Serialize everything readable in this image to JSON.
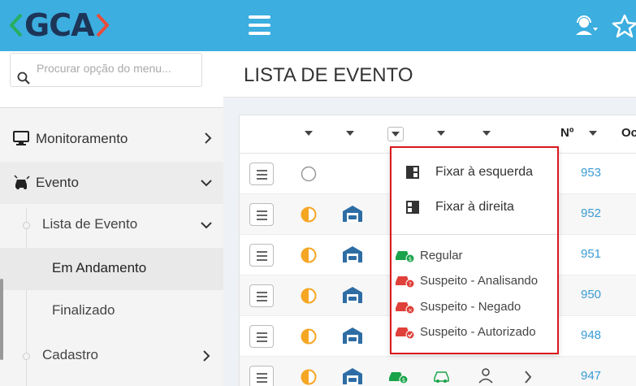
{
  "app": {
    "logo_text": "GCA"
  },
  "colors": {
    "topbar": "#3caee0",
    "accent_link": "#3a9bd5",
    "dropdown_border": "#d9191d",
    "regular_green": "#1aa34a",
    "suspect_red": "#e0403a",
    "status_orange": "#f5a623",
    "garage_blue": "#2e6da4"
  },
  "header": {
    "icons": [
      "hamburger-icon",
      "user-headset-icon",
      "star-icon"
    ]
  },
  "sidebar": {
    "search_placeholder": "Procurar opção do menu...",
    "items": [
      {
        "label": "Monitoramento",
        "icon": "monitor-icon"
      },
      {
        "label": "Evento",
        "icon": "car-alert-icon"
      }
    ],
    "subitems": [
      {
        "label": "Lista de Evento"
      },
      {
        "label": "Em Andamento"
      },
      {
        "label": "Finalizado"
      },
      {
        "label": "Cadastro"
      }
    ]
  },
  "main": {
    "page_title": "LISTA DE EVENTO",
    "grid": {
      "headers": {
        "number": "Nº",
        "next": "Oc"
      },
      "rows": [
        {
          "number": "953",
          "status": "empty"
        },
        {
          "number": "952",
          "status": "half"
        },
        {
          "number": "951",
          "status": "half"
        },
        {
          "number": "950",
          "status": "half"
        },
        {
          "number": "948",
          "status": "half"
        },
        {
          "number": "947",
          "status": "half"
        }
      ]
    },
    "dropdown": {
      "pin_left": "Fixar à esquerda",
      "pin_right": "Fixar à direita",
      "filters": [
        {
          "label": "Regular",
          "icon": "car-regular-icon",
          "color": "#1aa34a"
        },
        {
          "label": "Suspeito - Analisando",
          "icon": "car-question-icon",
          "color": "#e0403a"
        },
        {
          "label": "Suspeito - Negado",
          "icon": "car-denied-icon",
          "color": "#e0403a"
        },
        {
          "label": "Suspeito - Autorizado",
          "icon": "car-authorized-icon",
          "color": "#e0403a"
        }
      ]
    }
  }
}
